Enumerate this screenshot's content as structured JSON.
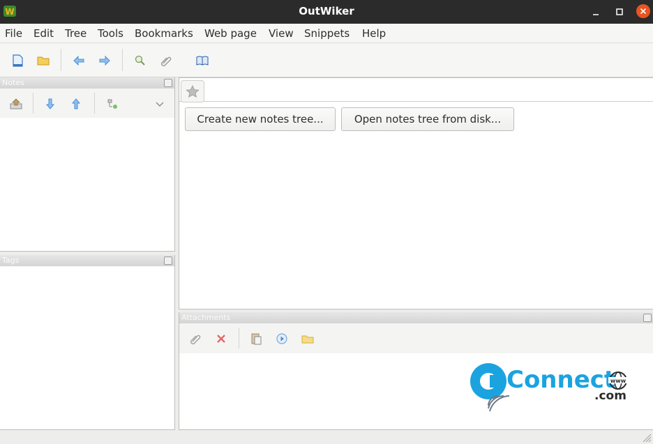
{
  "window": {
    "title": "OutWiker"
  },
  "menu": [
    "File",
    "Edit",
    "Tree",
    "Tools",
    "Bookmarks",
    "Web page",
    "View",
    "Snippets",
    "Help"
  ],
  "panels": {
    "notes": {
      "title": "Notes"
    },
    "tags": {
      "title": "Tags"
    },
    "attachments": {
      "title": "Attachments"
    }
  },
  "main": {
    "create_button": "Create new notes tree...",
    "open_button": "Open notes tree from disk..."
  },
  "watermark": {
    "text": "Connect",
    "suffix": ".com",
    "www": "www",
    "color": "#1ba3e0"
  },
  "colors": {
    "titlebar": "#2b2b2b",
    "close": "#e95420"
  },
  "icons": {
    "toolbar": [
      "new-file-icon",
      "open-folder-icon",
      "back-arrow-icon",
      "forward-arrow-icon",
      "search-page-icon",
      "attach-paperclip-icon",
      "open-book-icon"
    ],
    "notes_tools": [
      "move-up-level-icon",
      "move-down-icon",
      "move-up-icon",
      "tree-add-icon",
      "chevron-down-icon"
    ],
    "attach_tools": [
      "attach-paperclip-icon",
      "remove-x-icon",
      "paste-clipboard-icon",
      "execute-play-icon",
      "open-folder-icon"
    ]
  }
}
